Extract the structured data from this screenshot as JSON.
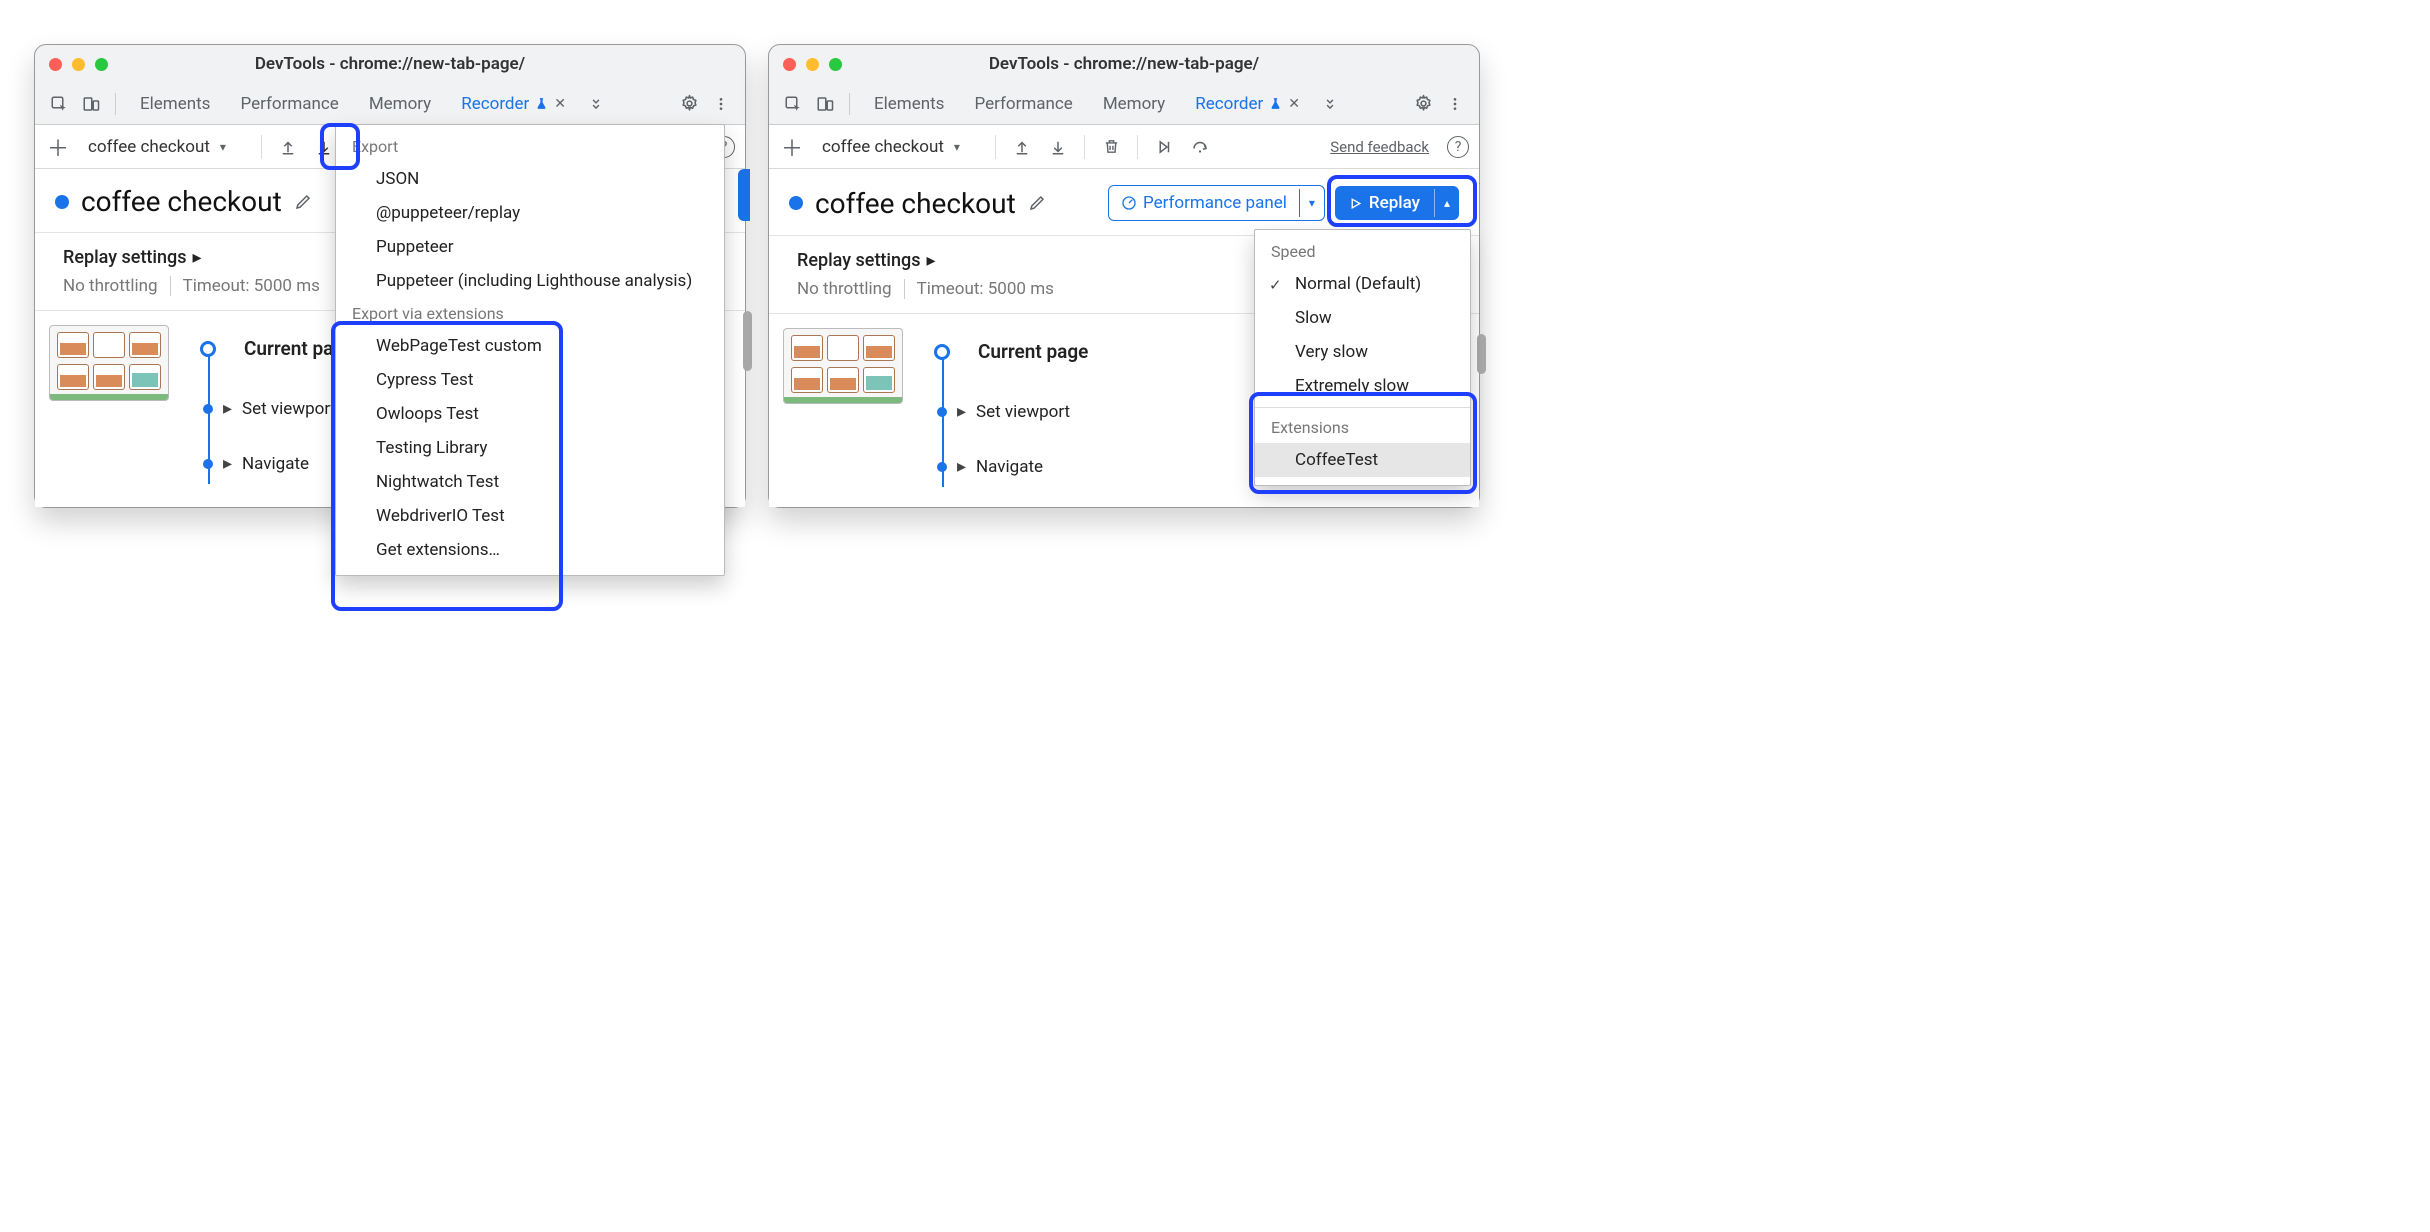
{
  "window_title": "DevTools - chrome://new-tab-page/",
  "tabs": {
    "elements": "Elements",
    "performance": "Performance",
    "memory": "Memory",
    "recorder": "Recorder"
  },
  "toolbar2": {
    "recording_name": "coffee checkout",
    "feedback": "Send feedback"
  },
  "recording": {
    "title": "coffee checkout"
  },
  "buttons": {
    "perf_panel": "Performance panel",
    "replay": "Replay"
  },
  "settings": {
    "header": "Replay settings",
    "throttle": "No throttling",
    "timeout": "Timeout: 5000 ms"
  },
  "steps": {
    "current_page": "Current page",
    "set_viewport": "Set viewport",
    "navigate": "Navigate"
  },
  "export_menu": {
    "header1": "Export",
    "json": "JSON",
    "puppeteer_replay": "@puppeteer/replay",
    "puppeteer": "Puppeteer",
    "puppeteer_lh": "Puppeteer (including Lighthouse analysis)",
    "header2": "Export via extensions",
    "wpt": "WebPageTest custom",
    "cypress": "Cypress Test",
    "owloops": "Owloops Test",
    "testing_library": "Testing Library",
    "nightwatch": "Nightwatch Test",
    "webdriverio": "WebdriverIO Test",
    "get_ext": "Get extensions…"
  },
  "speed_menu": {
    "header1": "Speed",
    "normal": "Normal (Default)",
    "slow": "Slow",
    "very_slow": "Very slow",
    "extremely_slow": "Extremely slow",
    "header2": "Extensions",
    "coffee_test": "CoffeeTest"
  }
}
